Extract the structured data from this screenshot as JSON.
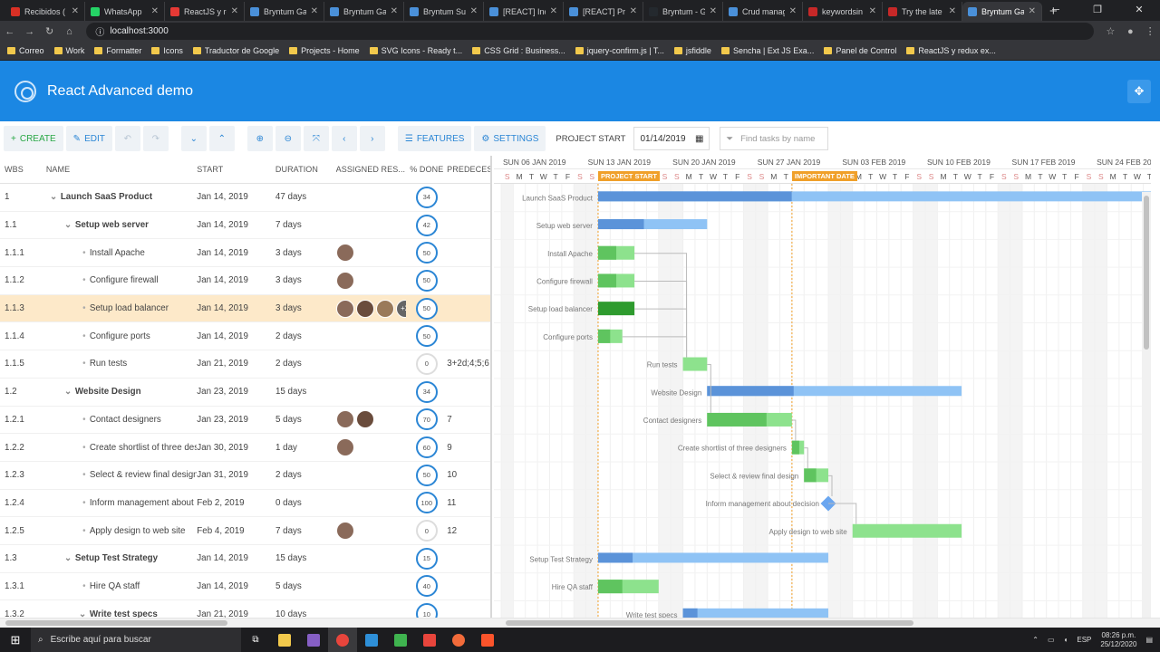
{
  "browser": {
    "tabs": [
      {
        "title": "Recibidos (",
        "color": "#d93025"
      },
      {
        "title": "WhatsApp",
        "color": "#25d366"
      },
      {
        "title": "ReactJS y re",
        "color": "#e53935"
      },
      {
        "title": "Bryntum Ga",
        "color": "#4a90d9"
      },
      {
        "title": "Bryntum Ga",
        "color": "#4a90d9"
      },
      {
        "title": "Bryntum Su",
        "color": "#4a90d9"
      },
      {
        "title": "[REACT] Inc",
        "color": "#4a90d9"
      },
      {
        "title": "[REACT] Pro",
        "color": "#4a90d9"
      },
      {
        "title": "Bryntum - G",
        "color": "#24292e"
      },
      {
        "title": "Crud manag",
        "color": "#4a90d9"
      },
      {
        "title": "keywordsin",
        "color": "#c62828"
      },
      {
        "title": "Try the late",
        "color": "#c62828"
      },
      {
        "title": "Bryntum Ga",
        "color": "#4a90d9",
        "active": true
      }
    ],
    "url": "localhost:3000",
    "bookmarks": [
      "Correo",
      "Work",
      "Formatter",
      "Icons",
      "Traductor de Google",
      "Projects - Home",
      "SVG Icons - Ready t...",
      "CSS Grid : Business...",
      "jquery-confirm.js | T...",
      "jsfiddle",
      "Sencha | Ext JS Exa...",
      "Panel de Control",
      "ReactJS y redux ex..."
    ]
  },
  "app": {
    "title": "React Advanced demo"
  },
  "toolbar": {
    "create": "CREATE",
    "edit": "EDIT",
    "features": "FEATURES",
    "settings": "SETTINGS",
    "project_start_label": "PROJECT START",
    "project_start_value": "01/14/2019",
    "find_placeholder": "Find tasks by name"
  },
  "grid": {
    "headers": {
      "wbs": "WBS",
      "name": "NAME",
      "start": "START",
      "duration": "DURATION",
      "resources": "ASSIGNED RES...",
      "percent": "% DONE",
      "pred": "PREDECESS"
    },
    "rows": [
      {
        "wbs": "1",
        "name": "Launch SaaS Product",
        "start": "Jan 14, 2019",
        "duration": "47 days",
        "pct": 34,
        "pred": "",
        "level": 0,
        "parent": true,
        "res": 0
      },
      {
        "wbs": "1.1",
        "name": "Setup web server",
        "start": "Jan 14, 2019",
        "duration": "7 days",
        "pct": 42,
        "pred": "",
        "level": 1,
        "parent": true,
        "res": 0
      },
      {
        "wbs": "1.1.1",
        "name": "Install Apache",
        "start": "Jan 14, 2019",
        "duration": "3 days",
        "pct": 50,
        "pred": "",
        "level": 2,
        "res": 1
      },
      {
        "wbs": "1.1.2",
        "name": "Configure firewall",
        "start": "Jan 14, 2019",
        "duration": "3 days",
        "pct": 50,
        "pred": "",
        "level": 2,
        "res": 1
      },
      {
        "wbs": "1.1.3",
        "name": "Setup load balancer",
        "start": "Jan 14, 2019",
        "duration": "3 days",
        "pct": 50,
        "pred": "",
        "level": 2,
        "res": 3,
        "more": "+2",
        "selected": true
      },
      {
        "wbs": "1.1.4",
        "name": "Configure ports",
        "start": "Jan 14, 2019",
        "duration": "2 days",
        "pct": 50,
        "pred": "",
        "level": 2,
        "res": 0
      },
      {
        "wbs": "1.1.5",
        "name": "Run tests",
        "start": "Jan 21, 2019",
        "duration": "2 days",
        "pct": 0,
        "pred": "3+2d;4;5;6",
        "level": 2,
        "res": 0
      },
      {
        "wbs": "1.2",
        "name": "Website Design",
        "start": "Jan 23, 2019",
        "duration": "15 days",
        "pct": 34,
        "pred": "",
        "level": 1,
        "parent": true,
        "res": 0
      },
      {
        "wbs": "1.2.1",
        "name": "Contact designers",
        "start": "Jan 23, 2019",
        "duration": "5 days",
        "pct": 70,
        "pred": "7",
        "level": 2,
        "res": 2
      },
      {
        "wbs": "1.2.2",
        "name": "Create shortlist of three designers",
        "start": "Jan 30, 2019",
        "duration": "1 day",
        "pct": 60,
        "pred": "9",
        "level": 2,
        "res": 1
      },
      {
        "wbs": "1.2.3",
        "name": "Select & review final design",
        "start": "Jan 31, 2019",
        "duration": "2 days",
        "pct": 50,
        "pred": "10",
        "level": 2,
        "res": 0
      },
      {
        "wbs": "1.2.4",
        "name": "Inform management about decision",
        "start": "Feb 2, 2019",
        "duration": "0 days",
        "pct": 100,
        "pred": "11",
        "level": 2,
        "res": 0
      },
      {
        "wbs": "1.2.5",
        "name": "Apply design to web site",
        "start": "Feb 4, 2019",
        "duration": "7 days",
        "pct": 0,
        "pred": "12",
        "level": 2,
        "res": 1
      },
      {
        "wbs": "1.3",
        "name": "Setup Test Strategy",
        "start": "Jan 14, 2019",
        "duration": "15 days",
        "pct": 15,
        "pred": "",
        "level": 1,
        "parent": true,
        "res": 0
      },
      {
        "wbs": "1.3.1",
        "name": "Hire QA staff",
        "start": "Jan 14, 2019",
        "duration": "5 days",
        "pct": 40,
        "pred": "",
        "level": 2,
        "res": 0
      },
      {
        "wbs": "1.3.2",
        "name": "Write test specs",
        "start": "Jan 21, 2019",
        "duration": "10 days",
        "pct": 10,
        "pred": "",
        "level": 2,
        "parent": true,
        "res": 0
      }
    ]
  },
  "gantt": {
    "weeks": [
      "SUN 06 JAN 2019",
      "SUN 13 JAN 2019",
      "SUN 20 JAN 2019",
      "SUN 27 JAN 2019",
      "SUN 03 FEB 2019",
      "SUN 10 FEB 2019",
      "SUN 17 FEB 2019",
      "SUN 24 FEB 20"
    ],
    "days": [
      "S",
      "M",
      "T",
      "W",
      "T",
      "F",
      "S"
    ],
    "project_start_label": "PROJECT START",
    "important_label": "IMPORTANT DATE",
    "project_start_day": 8,
    "important_day": 24,
    "view_start_day": 0,
    "tasks": [
      {
        "label": "Launch SaaS Product",
        "start": 8,
        "dur": 47,
        "pct": 34,
        "type": "parent"
      },
      {
        "label": "Setup web server",
        "start": 8,
        "dur": 9,
        "pct": 42,
        "type": "parent"
      },
      {
        "label": "Install Apache",
        "start": 8,
        "dur": 3,
        "pct": 50,
        "type": "task"
      },
      {
        "label": "Configure firewall",
        "start": 8,
        "dur": 3,
        "pct": 50,
        "type": "task"
      },
      {
        "label": "Setup load balancer",
        "start": 8,
        "dur": 3,
        "pct": 50,
        "type": "task",
        "selected": true
      },
      {
        "label": "Configure ports",
        "start": 8,
        "dur": 2,
        "pct": 50,
        "type": "task"
      },
      {
        "label": "Run tests",
        "start": 15,
        "dur": 2,
        "pct": 0,
        "type": "task"
      },
      {
        "label": "Website Design",
        "start": 17,
        "dur": 21,
        "pct": 34,
        "type": "parent"
      },
      {
        "label": "Contact designers",
        "start": 17,
        "dur": 7,
        "pct": 70,
        "type": "task"
      },
      {
        "label": "Create shortlist of three designers",
        "start": 24,
        "dur": 1,
        "pct": 60,
        "type": "task"
      },
      {
        "label": "Select & review final design",
        "start": 25,
        "dur": 2,
        "pct": 50,
        "type": "task"
      },
      {
        "label": "Inform management about decision",
        "start": 27,
        "dur": 0,
        "pct": 100,
        "type": "milestone"
      },
      {
        "label": "Apply design to web site",
        "start": 29,
        "dur": 9,
        "pct": 0,
        "type": "task"
      },
      {
        "label": "Setup Test Strategy",
        "start": 8,
        "dur": 19,
        "pct": 15,
        "type": "parent"
      },
      {
        "label": "Hire QA staff",
        "start": 8,
        "dur": 5,
        "pct": 40,
        "type": "task"
      },
      {
        "label": "Write test specs",
        "start": 15,
        "dur": 12,
        "pct": 10,
        "type": "parent"
      }
    ],
    "colors": {
      "parent": "#8fc3f5",
      "parent_done": "#5b93d9",
      "task": "#8de28d",
      "task_done": "#5fc45f",
      "selected": "#2e9b2e",
      "milestone": "#6aa6f0",
      "project_line": "#f0a02a",
      "important": "#f0a02a"
    }
  },
  "taskbar": {
    "search": "Escribe aquí para buscar",
    "lang": "ESP",
    "time": "08:26 p.m.",
    "date": "25/12/2020"
  }
}
